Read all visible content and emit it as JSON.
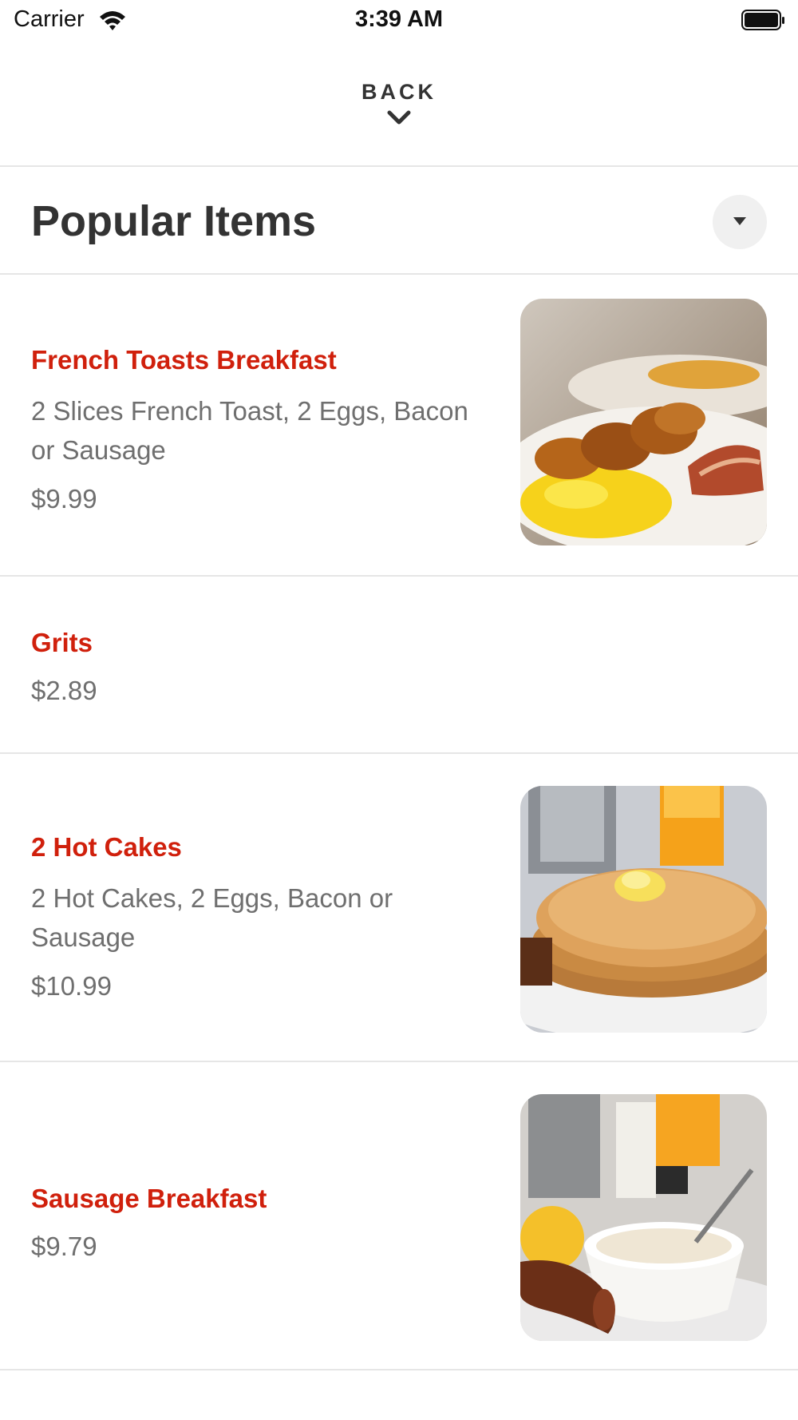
{
  "status_bar": {
    "carrier": "Carrier",
    "time": "3:39 AM"
  },
  "header": {
    "back_label": "BACK"
  },
  "section": {
    "title": "Popular Items"
  },
  "items": [
    {
      "name": "French Toasts Breakfast",
      "description": "2 Slices French Toast, 2 Eggs, Bacon or Sausage",
      "price": "$9.99"
    },
    {
      "name": "Grits",
      "price": "$2.89"
    },
    {
      "name": "2 Hot Cakes",
      "description": "2 Hot Cakes, 2 Eggs, Bacon or Sausage",
      "price": "$10.99"
    },
    {
      "name": "Sausage Breakfast",
      "price": "$9.79"
    }
  ],
  "colors": {
    "accent": "#d0200c",
    "text": "#333333",
    "muted": "#6f6f6f",
    "divider": "#e6e6e6"
  }
}
